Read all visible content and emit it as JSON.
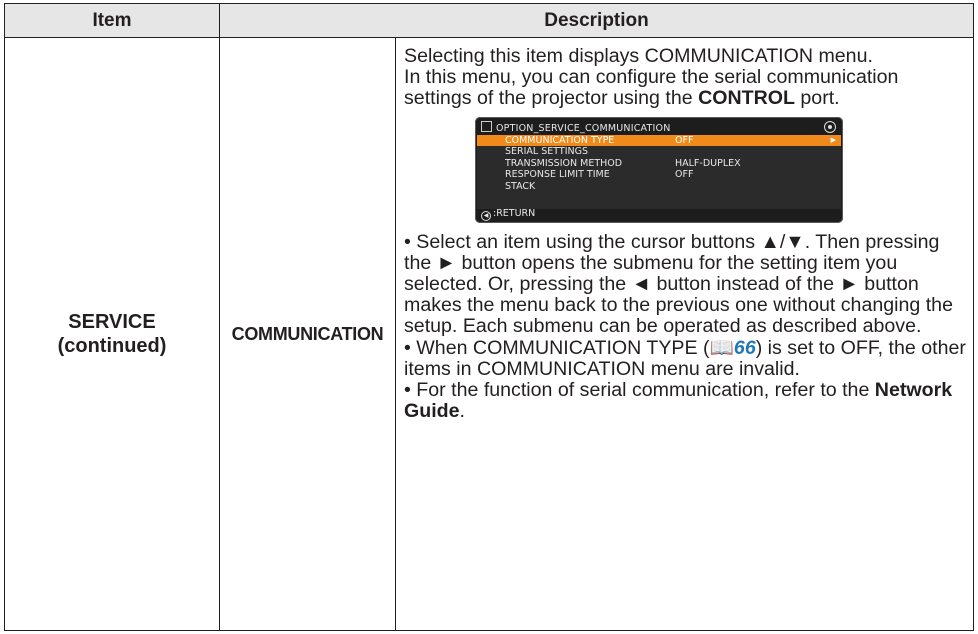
{
  "header": {
    "item": "Item",
    "description": "Description"
  },
  "row": {
    "item_line1": "SERVICE",
    "item_line2": "(continued)",
    "sub_item": "COMMUNICATION",
    "para1_a": "Selecting this item displays COMMUNICATION menu.",
    "para1_b": "In this menu, you can configure the serial communication settings of the projector using the ",
    "para1_bold": "CONTROL",
    "para1_c": " port.",
    "para2": "• Select an item using the cursor buttons ▲/▼. Then pressing the ► button opens the submenu for the setting item you selected. Or, pressing the ◄ button instead of the ► button makes the menu back to the previous one without changing the setup. Each submenu can be operated as described above.",
    "para3_a": "• When COMMUNICATION TYPE (",
    "para3_icon": "book-icon",
    "para3_ref": "66",
    "para3_b": ") is set to OFF, the other items in COMMUNICATION menu are invalid.",
    "para4_a": "• For the function of serial communication, refer to the ",
    "para4_bold": "Network Guide",
    "para4_c": "."
  },
  "osd": {
    "title": "OPTION_SERVICE_COMMUNICATION",
    "items": [
      {
        "label": "COMMUNICATION TYPE",
        "value": "OFF"
      },
      {
        "label": "SERIAL SETTINGS",
        "value": ""
      },
      {
        "label": "TRANSMISSION METHOD",
        "value": "HALF-DUPLEX"
      },
      {
        "label": "RESPONSE LIMIT TIME",
        "value": "OFF"
      },
      {
        "label": "STACK",
        "value": ""
      }
    ],
    "return_label": ":RETURN",
    "highlight_color": "#f08a1a"
  }
}
